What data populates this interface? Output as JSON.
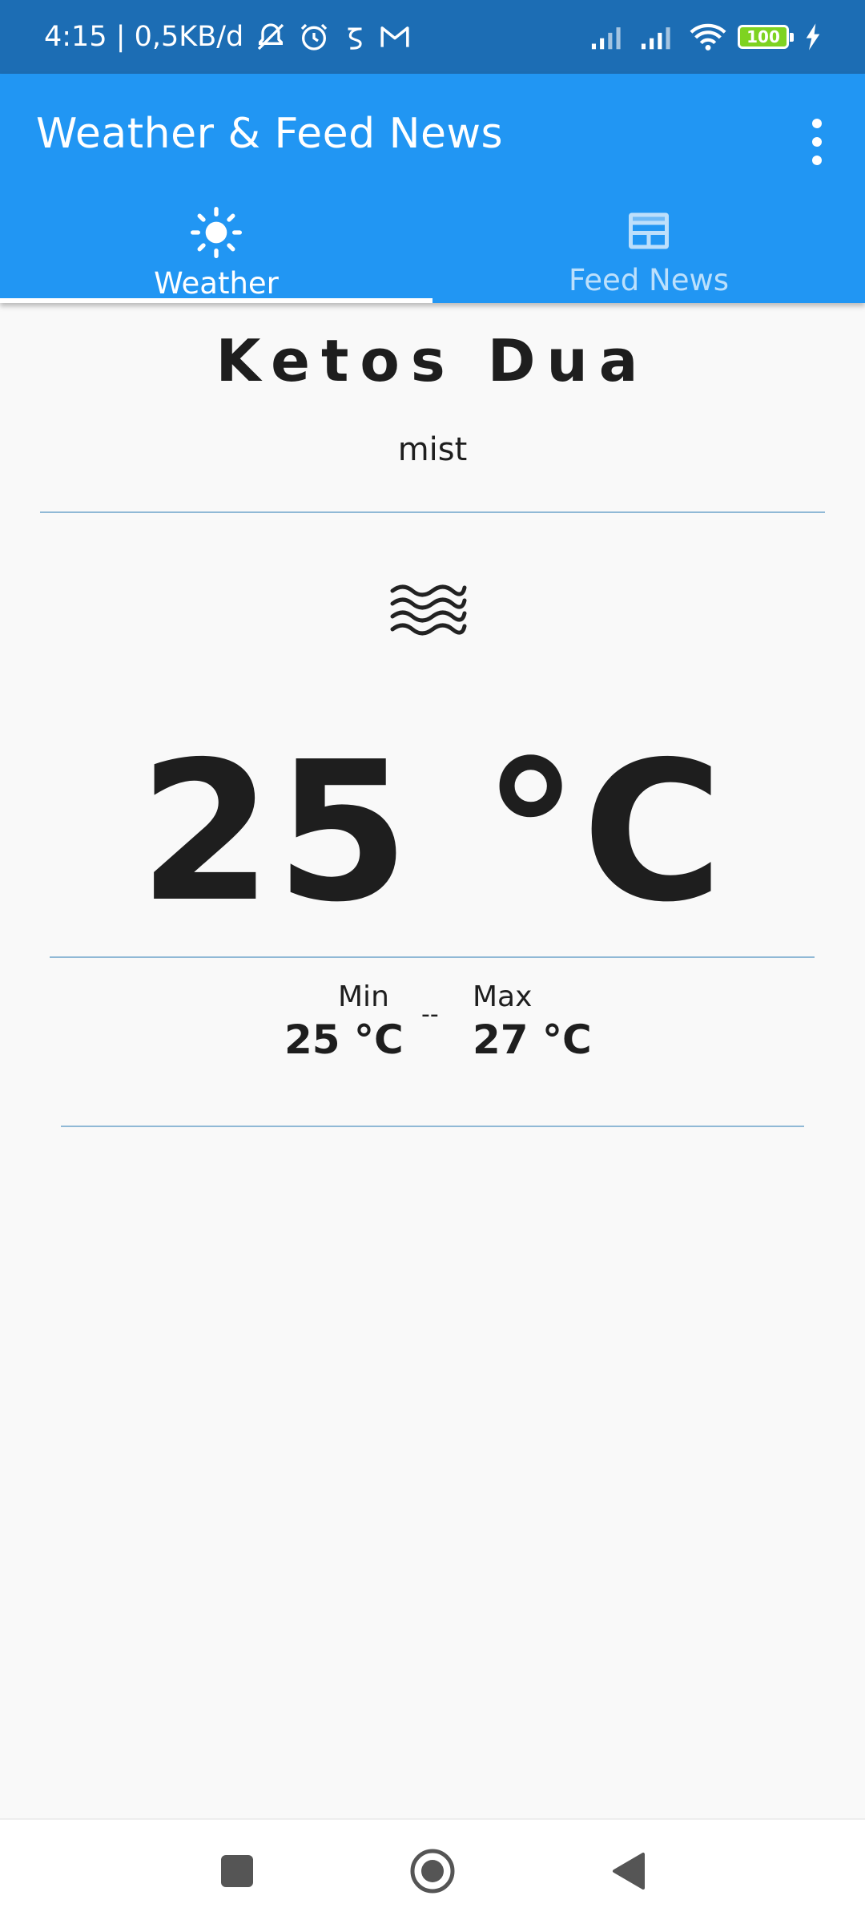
{
  "status_bar": {
    "time_and_speed": "4:15 | 0,5KB/d",
    "battery": "100"
  },
  "app_bar": {
    "title": "Weather & Feed News"
  },
  "tabs": [
    {
      "label": "Weather",
      "icon": "sun-icon",
      "selected": true
    },
    {
      "label": "Feed News",
      "icon": "newspaper-icon",
      "selected": false
    }
  ],
  "weather": {
    "city": "Ketos Dua",
    "description": "mist",
    "icon": "mist-icon",
    "temperature": "25 °C",
    "min_label": "Min",
    "min_value": "25 °C",
    "separator": "--",
    "max_label": "Max",
    "max_value": "27 °C"
  },
  "colors": {
    "status_bar": "#1c6db4",
    "app_bar": "#2196f3",
    "divider": "#90b9d6",
    "background": "#f9f9f9"
  }
}
